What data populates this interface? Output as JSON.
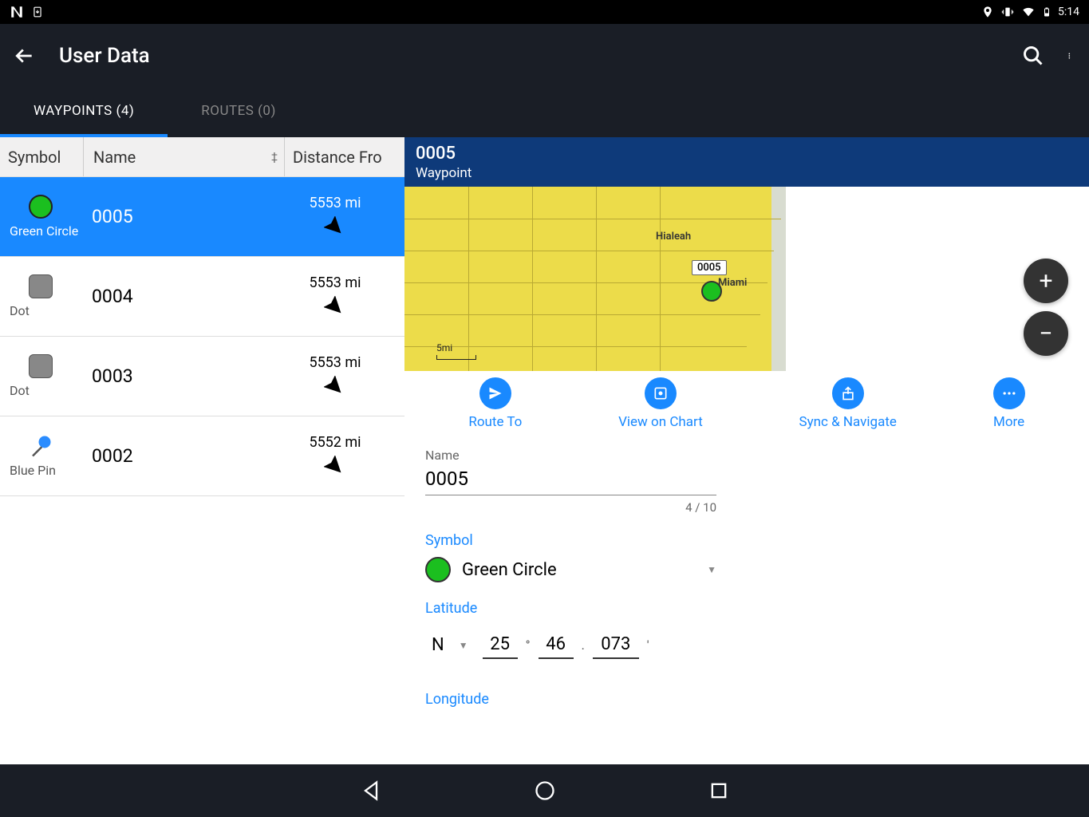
{
  "status_bar": {
    "time": "5:14"
  },
  "app_bar": {
    "title": "User Data"
  },
  "tabs": {
    "waypoints": "WAYPOINTS (4)",
    "routes": "ROUTES (0)"
  },
  "table": {
    "headers": {
      "symbol": "Symbol",
      "name": "Name",
      "distance": "Distance Fro"
    },
    "rows": [
      {
        "symbol_label": "Green Circle",
        "name": "0005",
        "distance": "5553 mi"
      },
      {
        "symbol_label": "Dot",
        "name": "0004",
        "distance": "5553 mi"
      },
      {
        "symbol_label": "Dot",
        "name": "0003",
        "distance": "5553 mi"
      },
      {
        "symbol_label": "Blue Pin",
        "name": "0002",
        "distance": "5552 mi"
      }
    ]
  },
  "detail": {
    "title": "0005",
    "subtitle": "Waypoint",
    "map": {
      "hialeah": "Hialeah",
      "miami": "Miami",
      "wp_label": "0005",
      "scale": "5mi"
    },
    "actions": {
      "route_to": "Route To",
      "view_on_chart": "View on Chart",
      "sync_navigate": "Sync & Navigate",
      "more": "More"
    },
    "form": {
      "name_label": "Name",
      "name_value": "0005",
      "char_count": "4 / 10",
      "symbol_label": "Symbol",
      "symbol_value": "Green Circle",
      "latitude_label": "Latitude",
      "lat_hemi": "N",
      "lat_deg": "25",
      "lat_min": "46",
      "lat_dec": "073",
      "longitude_label": "Longitude"
    }
  }
}
